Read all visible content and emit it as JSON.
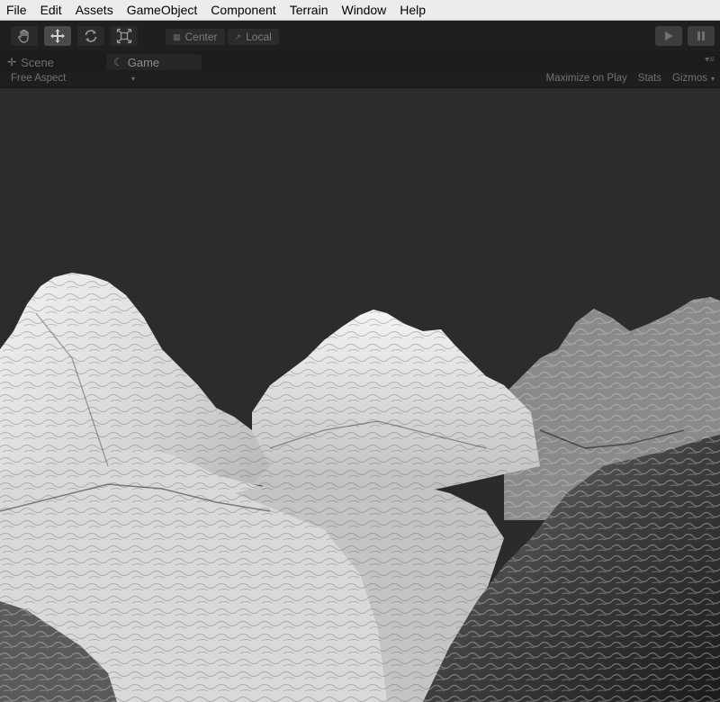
{
  "menu": {
    "items": [
      "File",
      "Edit",
      "Assets",
      "GameObject",
      "Component",
      "Terrain",
      "Window",
      "Help"
    ]
  },
  "toolbar": {
    "tools": [
      {
        "icon": "hand-tool-icon",
        "active": false
      },
      {
        "icon": "move-tool-icon",
        "active": true
      },
      {
        "icon": "rotate-tool-icon",
        "active": false
      },
      {
        "icon": "scale-tool-icon",
        "active": false
      }
    ],
    "pivot_label": "Center",
    "space_label": "Local",
    "play_icon": "play-icon",
    "pause_icon": "pause-icon"
  },
  "tabs": {
    "scene_label": "Scene",
    "game_label": "Game"
  },
  "game_toolbar": {
    "aspect_label": "Free Aspect",
    "maximize_label": "Maximize on Play",
    "stats_label": "Stats",
    "gizmos_label": "Gizmos"
  },
  "viewport": {
    "background_color": "#2c2c2c",
    "content": "terrain-render"
  }
}
